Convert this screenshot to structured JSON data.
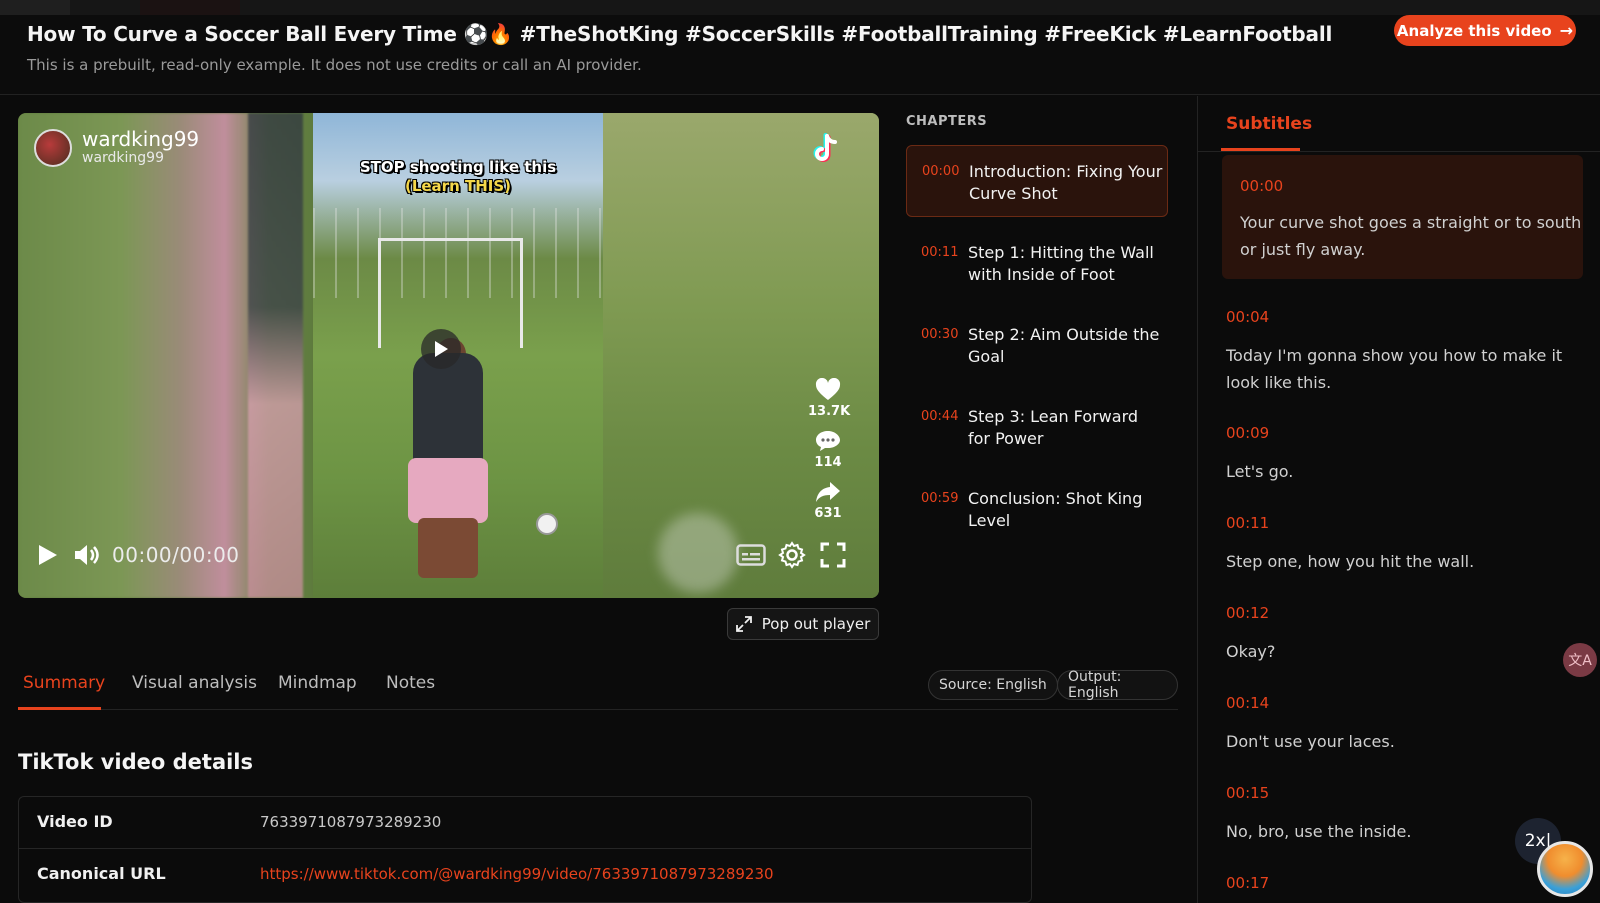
{
  "header": {
    "title": "How To Curve a Soccer Ball Every Time ⚽🔥 #TheShotKing #SoccerSkills #FootballTraining #FreeKick #LearnFootball",
    "subtitle": "This is a prebuilt, read-only example. It does not use credits or call an AI provider.",
    "analyze_label": "Analyze this video"
  },
  "player": {
    "overlay_line1": "STOP shooting like this",
    "overlay_line2": "(Learn THIS)",
    "username": "wardking99",
    "handle": "wardking99",
    "likes": "13.7K",
    "comments": "114",
    "shares": "631",
    "time": "00:00/00:00",
    "popout_label": "Pop out player"
  },
  "chapters": {
    "heading": "CHAPTERS",
    "items": [
      {
        "time": "00:00",
        "label": "Introduction: Fixing Your Curve Shot"
      },
      {
        "time": "00:11",
        "label": "Step 1: Hitting the Wall with Inside of Foot"
      },
      {
        "time": "00:30",
        "label": "Step 2: Aim Outside the Goal"
      },
      {
        "time": "00:44",
        "label": "Step 3: Lean Forward for Power"
      },
      {
        "time": "00:59",
        "label": "Conclusion: Shot King Level"
      }
    ]
  },
  "tabs": {
    "items": [
      "Summary",
      "Visual analysis",
      "Mindmap",
      "Notes"
    ],
    "source": "Source: English",
    "output": "Output: English"
  },
  "details": {
    "title": "TikTok video details",
    "rows": [
      {
        "key": "Video ID",
        "value": "7633971087973289230"
      },
      {
        "key": "Canonical URL",
        "value": "https://www.tiktok.com/@wardking99/video/7633971087973289230"
      }
    ]
  },
  "subtitles": {
    "tab_label": "Subtitles",
    "items": [
      {
        "time": "00:00",
        "text": "Your curve shot goes a straight or to south or just fly away."
      },
      {
        "time": "00:04",
        "text": "Today I'm gonna show you how to make it look like this."
      },
      {
        "time": "00:09",
        "text": "Let's go."
      },
      {
        "time": "00:11",
        "text": "Step one, how you hit the wall."
      },
      {
        "time": "00:12",
        "text": "Okay?"
      },
      {
        "time": "00:14",
        "text": "Don't use your laces."
      },
      {
        "time": "00:15",
        "text": "No, bro, use the inside."
      },
      {
        "time": "00:17",
        "text": ""
      }
    ]
  },
  "speed_badge": "2x|",
  "translate_icon_glyph": "文A",
  "colors": {
    "accent": "#e8431d",
    "background": "#0b0b0b",
    "active_chapter_bg": "#2a130c"
  }
}
